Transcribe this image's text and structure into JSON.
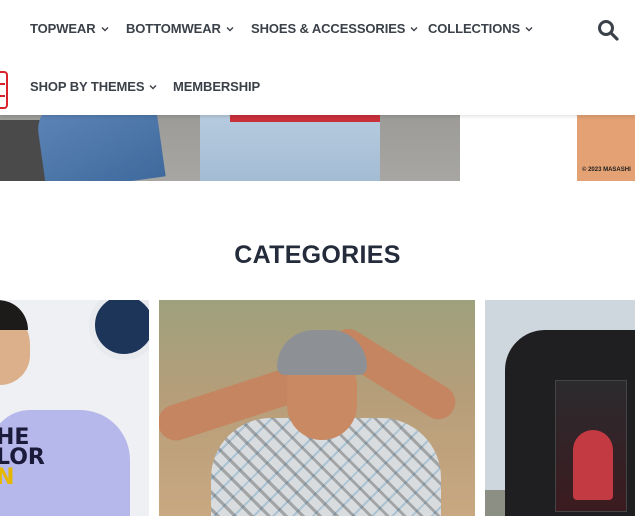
{
  "header": {
    "nav": [
      {
        "label": "TOPWEAR",
        "has_dropdown": true
      },
      {
        "label": "BOTTOMWEAR",
        "has_dropdown": true
      },
      {
        "label": "SHOES & ACCESSORIES",
        "has_dropdown": true
      },
      {
        "label": "COLLECTIONS",
        "has_dropdown": true
      },
      {
        "label": "SHOP BY THEMES",
        "has_dropdown": true
      },
      {
        "label": "MEMBERSHIP",
        "has_dropdown": false
      }
    ],
    "search_icon": "search-icon",
    "dropdown_icon": "chevron-down-icon"
  },
  "hero": {
    "copyright": "© 2023 MASASHI"
  },
  "categories": {
    "heading": "CATEGORIES",
    "card1_print": [
      "HE",
      "LOR",
      "N"
    ]
  },
  "colors": {
    "text": "#3b4148",
    "heading": "#242c3b",
    "logo_red": "#d8232a"
  }
}
